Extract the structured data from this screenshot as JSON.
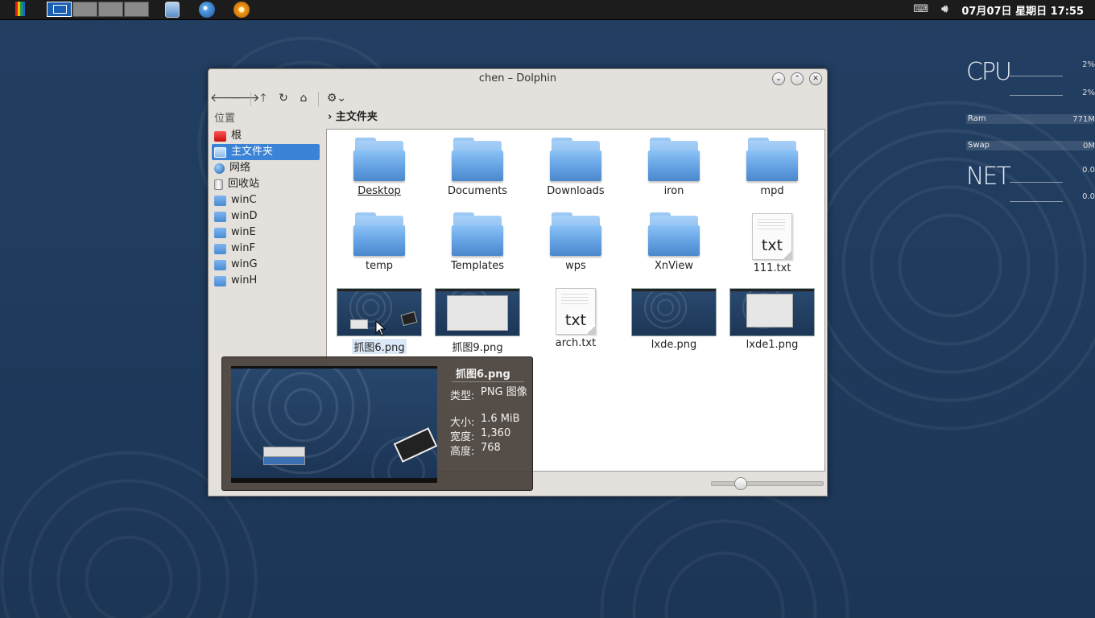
{
  "panel": {
    "clock": "07月07日 星期日 17:55",
    "icons": [
      "menu-logo-icon",
      "file-manager-icon",
      "browser-icon",
      "xnview-icon"
    ]
  },
  "conky": {
    "cpu_label": "CPU",
    "cpu_vals": [
      "2%",
      "2%"
    ],
    "ram_label": "Ram",
    "ram_val": "771M",
    "swap_label": "Swap",
    "swap_val": "0M",
    "net_label": "NET",
    "net_vals": [
      "0.0",
      "0.0"
    ]
  },
  "window": {
    "title": "chen – Dolphin",
    "breadcrumb": "主文件夹",
    "places_header": "位置",
    "places": [
      {
        "label": "根",
        "icon": "root-folder-icon"
      },
      {
        "label": "主文件夹",
        "icon": "home-folder-icon",
        "selected": true
      },
      {
        "label": "网络",
        "icon": "network-icon"
      },
      {
        "label": "回收站",
        "icon": "trash-icon"
      },
      {
        "label": "winC",
        "icon": "folder-icon"
      },
      {
        "label": "winD",
        "icon": "folder-icon"
      },
      {
        "label": "winE",
        "icon": "folder-icon"
      },
      {
        "label": "winF",
        "icon": "folder-icon"
      },
      {
        "label": "winG",
        "icon": "folder-icon"
      },
      {
        "label": "winH",
        "icon": "folder-icon"
      }
    ],
    "files": [
      {
        "name": "Desktop",
        "type": "folder"
      },
      {
        "name": "Documents",
        "type": "folder"
      },
      {
        "name": "Downloads",
        "type": "folder"
      },
      {
        "name": "iron",
        "type": "folder"
      },
      {
        "name": "mpd",
        "type": "folder"
      },
      {
        "name": "temp",
        "type": "folder"
      },
      {
        "name": "Templates",
        "type": "folder"
      },
      {
        "name": "wps",
        "type": "folder"
      },
      {
        "name": "XnView",
        "type": "folder"
      },
      {
        "name": "111.txt",
        "type": "text",
        "ext": "txt"
      },
      {
        "name": "抓图6.png",
        "type": "image"
      },
      {
        "name": "抓图9.png",
        "type": "image"
      },
      {
        "name": "arch.txt",
        "type": "text",
        "ext": "txt"
      },
      {
        "name": "lxde.png",
        "type": "image"
      },
      {
        "name": "lxde1.png",
        "type": "image"
      }
    ]
  },
  "tooltip": {
    "name": "抓图6.png",
    "type_label": "类型:",
    "type_value": "PNG 图像",
    "size_label": "大小:",
    "size_value": "1.6 MiB",
    "width_label": "宽度:",
    "width_value": "1,360",
    "height_label": "高度:",
    "height_value": "768"
  }
}
